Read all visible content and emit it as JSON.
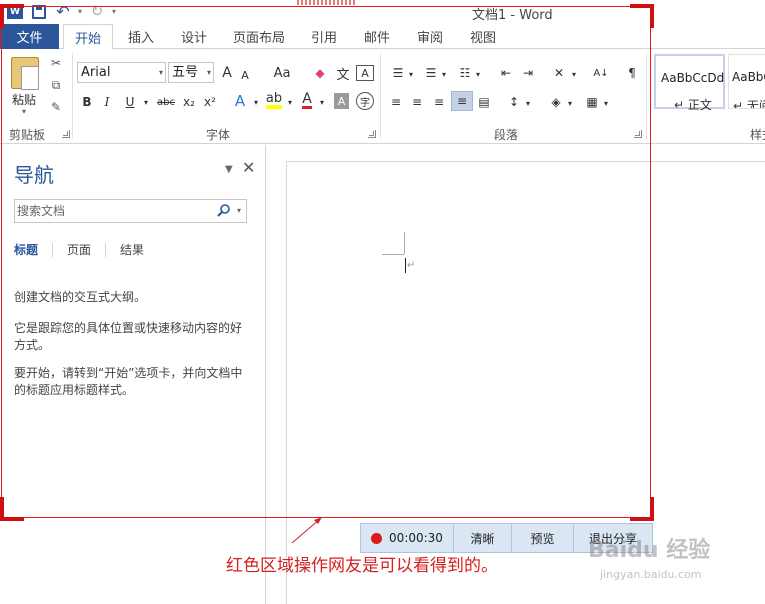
{
  "window": {
    "title": "文档1 - Word"
  },
  "quick_access": {
    "icons": [
      "word-logo-icon",
      "save-icon",
      "undo-icon",
      "redo-icon",
      "customize-caret-icon"
    ]
  },
  "tabs": {
    "file": "文件",
    "items": [
      "开始",
      "插入",
      "设计",
      "页面布局",
      "引用",
      "邮件",
      "审阅",
      "视图"
    ],
    "active": "开始"
  },
  "ribbon": {
    "clipboard": {
      "paste_label": "粘贴",
      "group_label": "剪贴板"
    },
    "font": {
      "font_name": "Arial",
      "font_size": "五号",
      "grow_label": "A",
      "shrink_label": "A",
      "case_label": "Aa",
      "phonetic_label": "文",
      "border_label": "A",
      "bold": "B",
      "italic": "I",
      "underline": "U",
      "strike": "abc",
      "subscript": "x₂",
      "superscript": "x²",
      "effects_label": "A",
      "font_color_label": "A",
      "shading_label": "A",
      "enclose_label": "字",
      "group_label": "字体"
    },
    "paragraph": {
      "group_label": "段落"
    },
    "styles": {
      "items": [
        {
          "sample": "AaBbCcDd",
          "name": "↵ 正文"
        },
        {
          "sample": "AaBbC",
          "name": "↵ 无间"
        }
      ],
      "group_label": "样式"
    }
  },
  "nav": {
    "title": "导航",
    "search_placeholder": "搜索文档",
    "tabs": [
      "标题",
      "页面",
      "结果"
    ],
    "text1": "创建文档的交互式大纲。",
    "text2": "它是跟踪您的具体位置或快速移动内容的好方式。",
    "text3": "要开始，请转到“开始”选项卡，并向文档中的标题应用标题样式。"
  },
  "document": {
    "paragraph_mark": "↵"
  },
  "share_bar": {
    "timer": "00:00:30",
    "clear": "清晰",
    "preview": "预览",
    "exit": "退出分享"
  },
  "annotation": {
    "text": "红色区域操作网友是可以看得到的。"
  },
  "watermark": {
    "brand": "Baidu 经验",
    "url": "jingyan.baidu.com"
  },
  "colors": {
    "word_blue": "#2b579a",
    "red_region": "#e81b1b",
    "share_bar_bg": "#dbe6f4",
    "record_dot": "#d91b1b"
  }
}
